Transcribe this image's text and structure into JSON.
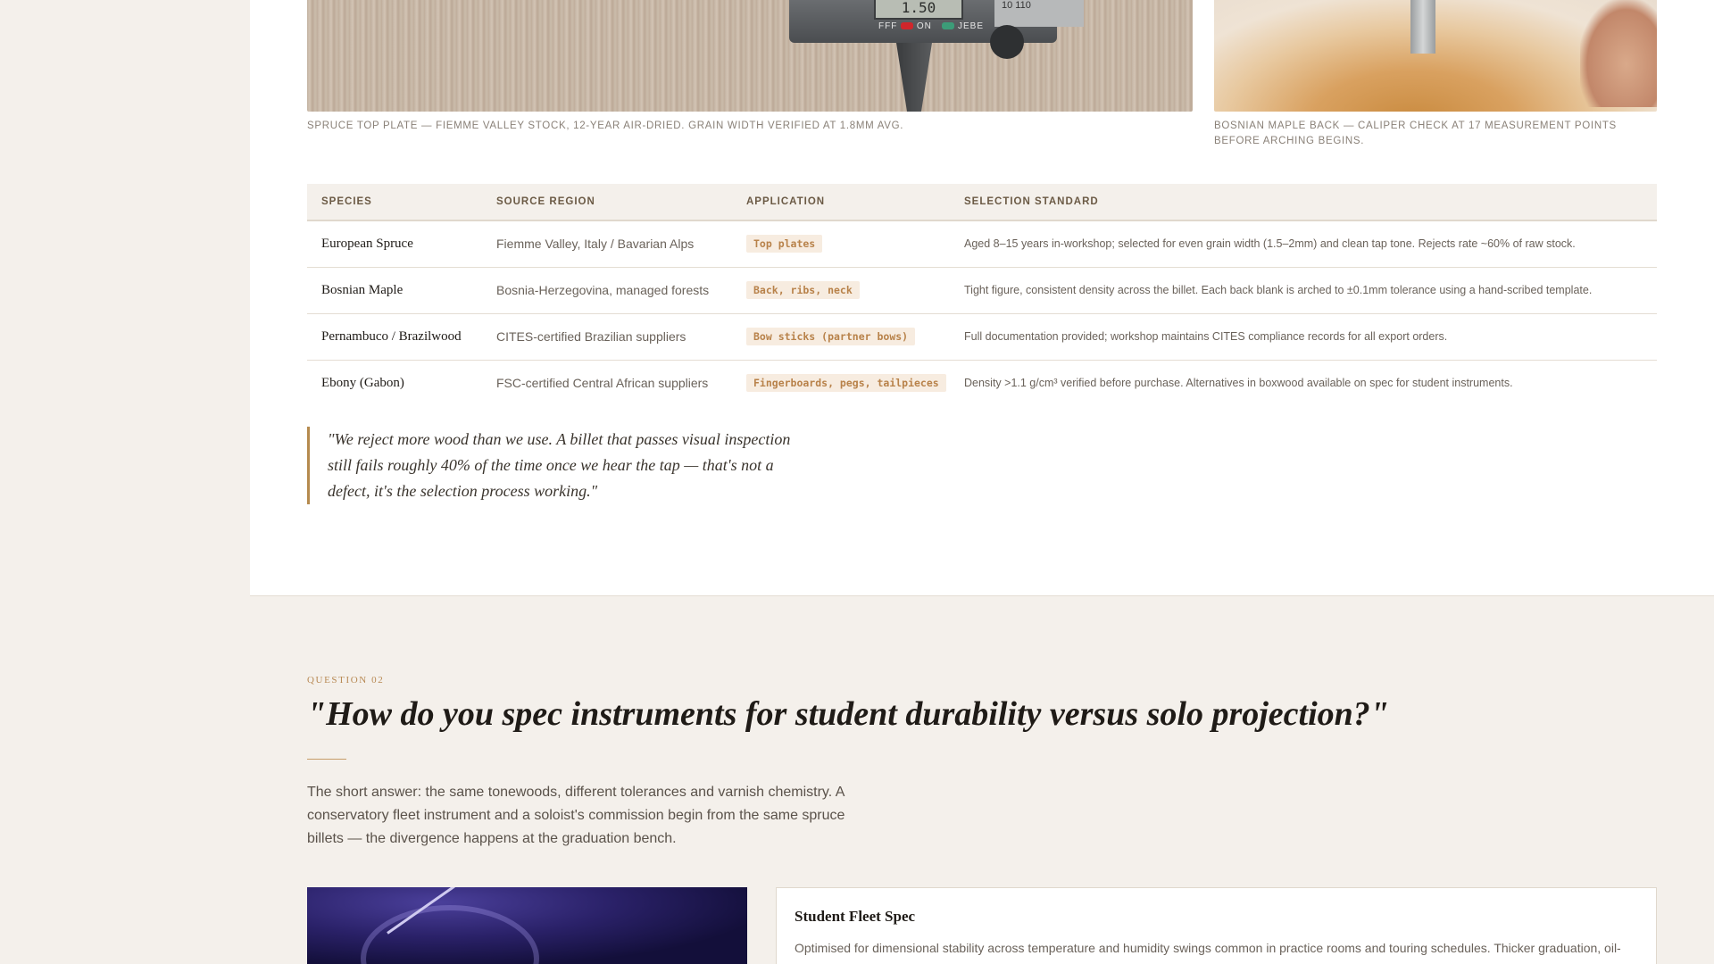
{
  "photos": {
    "spruce": {
      "caption": "Spruce top plate — Fiemme Valley stock, 12-year air-dried. Grain width verified at 1.8mm avg.",
      "caliper_reading": "1.50",
      "caliper_labels": [
        "FFF",
        "ON",
        "JEBE"
      ],
      "scale_text": "10  110"
    },
    "maple": {
      "caption": "Bosnian maple back — caliper check at 17 measurement points before arching begins."
    }
  },
  "table": {
    "headers": [
      "SPECIES",
      "SOURCE REGION",
      "APPLICATION",
      "SELECTION STANDARD"
    ],
    "rows": [
      {
        "species": "European Spruce",
        "region": "Fiemme Valley, Italy / Bavarian Alps",
        "application": "Top plates",
        "standard": "Aged 8–15 years in-workshop; selected for even grain width (1.5–2mm) and clean tap tone. Rejects rate ~60% of raw stock."
      },
      {
        "species": "Bosnian Maple",
        "region": "Bosnia-Herzegovina, managed forests",
        "application": "Back, ribs, neck",
        "standard": "Tight figure, consistent density across the billet. Each back blank is arched to ±0.1mm tolerance using a hand-scribed template."
      },
      {
        "species": "Pernambuco / Brazilwood",
        "region": "CITES-certified Brazilian suppliers",
        "application": "Bow sticks (partner bows)",
        "standard": "Full documentation provided; workshop maintains CITES compliance records for all export orders."
      },
      {
        "species": "Ebony (Gabon)",
        "region": "FSC-certified Central African suppliers",
        "application": "Fingerboards, pegs, tailpieces",
        "standard": "Density >1.1 g/cm³ verified before purchase. Alternatives in boxwood available on spec for student instruments."
      }
    ]
  },
  "quote": "\"We reject more wood than we use. A billet that passes visual inspection still fails roughly 40% of the time once we hear the tap — that's not a defect, it's the selection process working.\"",
  "question": {
    "label": "QUESTION 02",
    "title": "\"How do you spec instruments for student durability versus solo projection?\"",
    "body": "The short answer: the same tonewoods, different tolerances and varnish chemistry. A conservatory fleet instrument and a soloist's commission begin from the same spruce billets — the divergence happens at the graduation bench."
  },
  "spec_card": {
    "title": "Student Fleet Spec",
    "body": "Optimised for dimensional stability across temperature and humidity swings common in practice rooms and touring schedules. Thicker graduation, oil-"
  }
}
